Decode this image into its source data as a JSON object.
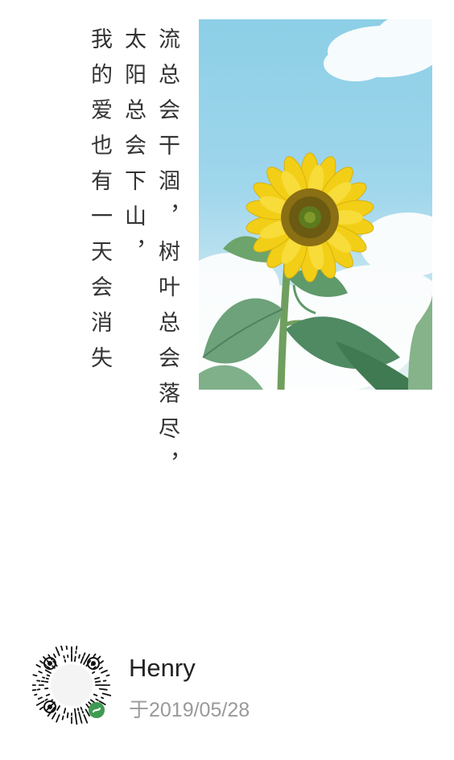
{
  "poem": {
    "columns": [
      "流总会干涸，树叶总会落尽，",
      "太阳总会下山，",
      "我的爱也有一天会消失"
    ]
  },
  "photo": {
    "icon": "sunflower-photo",
    "colors": {
      "sky": "#9fd6ec",
      "petal": "#f2d21b",
      "center": "#6b5a12",
      "leaf": "#5f9a6a"
    }
  },
  "footer": {
    "author": "Henry",
    "date": "于2019/05/28",
    "qr_icon": "mini-program-code-icon",
    "badge_color": "#3f9a52"
  }
}
